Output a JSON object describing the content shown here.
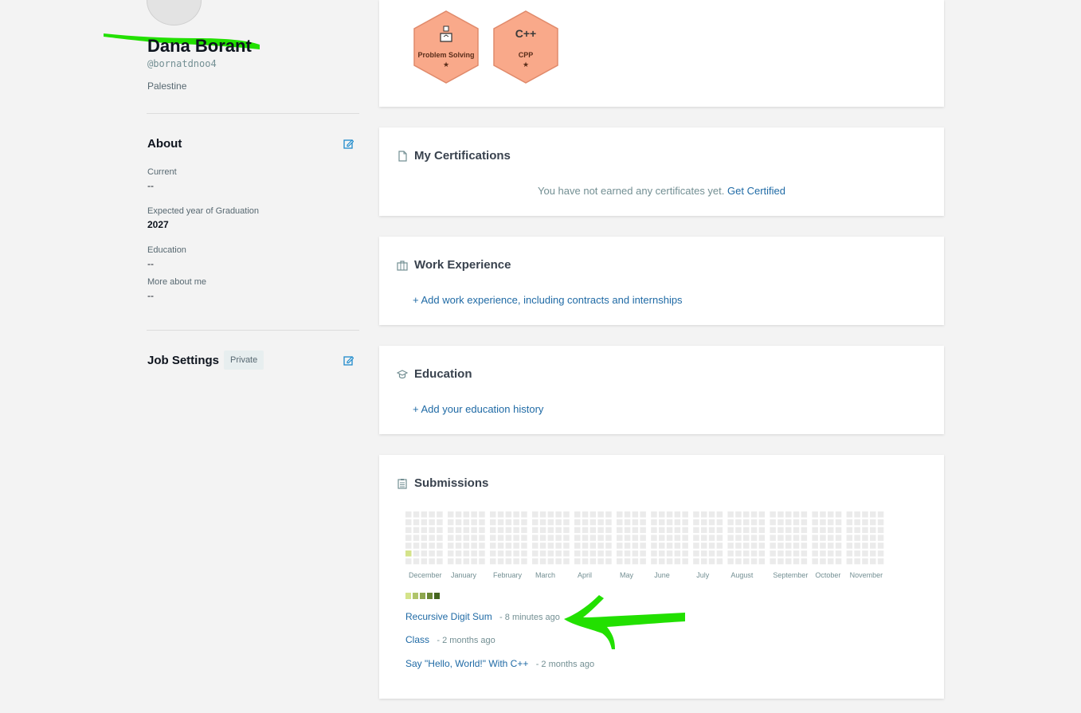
{
  "profile": {
    "name": "Dana Borant",
    "username": "@bornatdnoo4",
    "country": "Palestine"
  },
  "about": {
    "title": "About",
    "fields": [
      {
        "label": "Current",
        "value": "--"
      },
      {
        "label": "Expected year of Graduation",
        "value": "2027"
      },
      {
        "label": "Education",
        "value": "--"
      },
      {
        "label": "More about me",
        "value": "--"
      }
    ]
  },
  "job_settings": {
    "title": "Job Settings",
    "badge": "Private"
  },
  "badges": [
    {
      "name": "Problem Solving",
      "stars": "★",
      "icon": "puzzle-icon"
    },
    {
      "name": "CPP",
      "stars": "★",
      "icon": "cpp-icon",
      "glyph": "C++"
    }
  ],
  "certifications": {
    "title": "My Certifications",
    "message": "You have not earned any certificates yet.",
    "link": "Get Certified"
  },
  "work_experience": {
    "title": "Work Experience",
    "link": "+ Add work experience, including contracts and internships"
  },
  "education": {
    "title": "Education",
    "link": "+ Add your education history"
  },
  "submissions": {
    "title": "Submissions",
    "months": [
      "December",
      "January",
      "February",
      "March",
      "April",
      "May",
      "June",
      "July",
      "August",
      "September",
      "October",
      "November"
    ],
    "legend_colors": [
      "#d4e38a",
      "#b0c46b",
      "#8da64e",
      "#6a8735",
      "#45651f"
    ],
    "items": [
      {
        "title": "Recursive Digit Sum",
        "time": "- 8 minutes ago"
      },
      {
        "title": "Class",
        "time": "- 2 months ago"
      },
      {
        "title": "Say \"Hello, World!\" With C++",
        "time": "- 2 months ago"
      }
    ]
  },
  "colors": {
    "link": "#1f6aa5",
    "badge_fill": "#f9a98a",
    "badge_stroke": "#e08a6b",
    "highlight": "#22e000",
    "cell_empty": "#ebebeb",
    "cell_active": "#d4e38a"
  }
}
